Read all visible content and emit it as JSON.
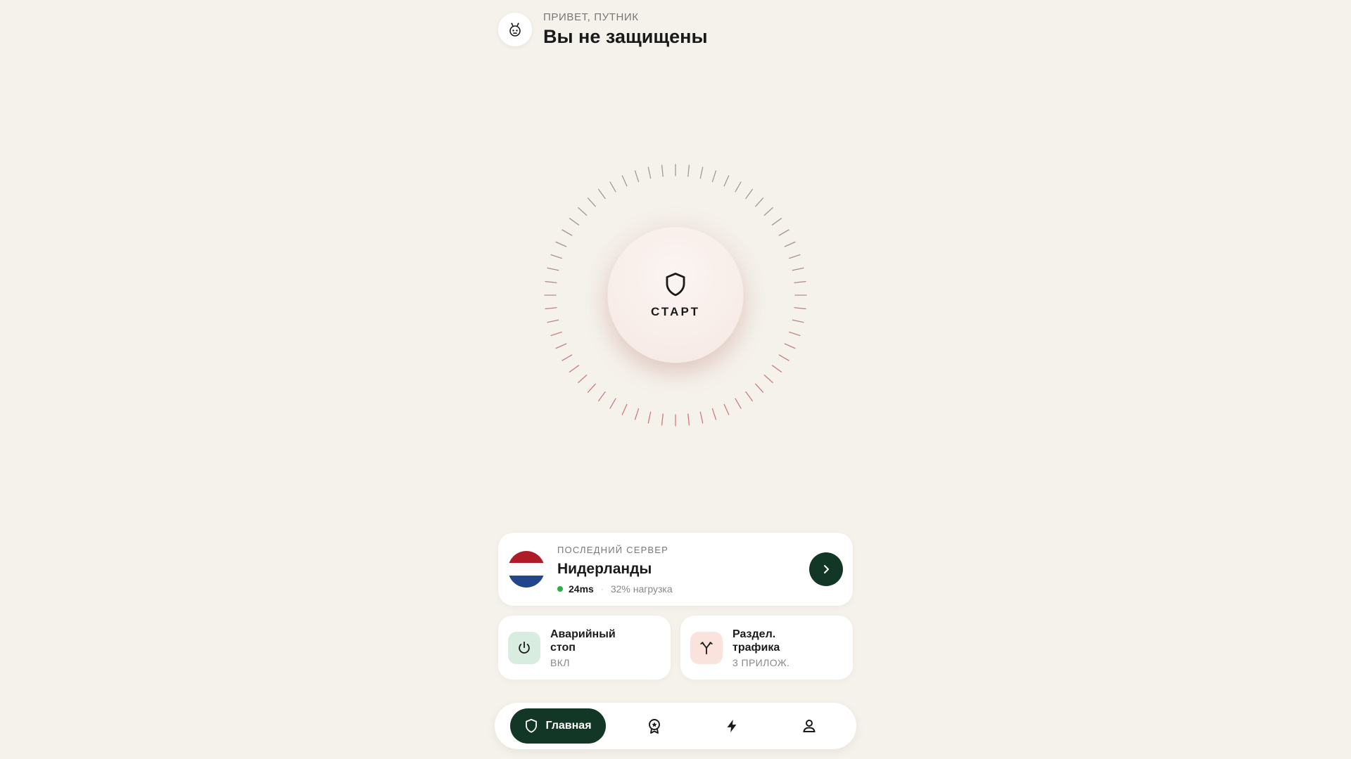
{
  "header": {
    "greeting": "ПРИВЕТ, ПУТНИК",
    "status_title": "Вы не защищены",
    "avatar_icon": "robot-icon"
  },
  "dial": {
    "button_label": "СТАРТ",
    "button_icon": "shield-icon",
    "tick_count": 60
  },
  "server": {
    "caption": "ПОСЛЕДНИЙ СЕРВЕР",
    "name": "Нидерланды",
    "ping": "24ms",
    "load": "32% нагрузка",
    "flag_colors": [
      "#ae1c28",
      "#ffffff",
      "#21468b"
    ],
    "status_color": "#27b24a",
    "action_icon": "chevron-right-icon"
  },
  "tiles": [
    {
      "title": "Аварийный стоп",
      "subtitle": "ВКЛ",
      "icon": "power-icon",
      "icon_bg": "#d9ece0"
    },
    {
      "title": "Раздел. трафика",
      "subtitle": "3 ПРИЛОЖ.",
      "icon": "split-icon",
      "icon_bg": "#fbe3dd"
    }
  ],
  "nav": {
    "home_label": "Главная",
    "items": [
      "shield-icon",
      "award-icon",
      "bolt-icon",
      "user-icon"
    ]
  },
  "colors": {
    "background": "#f5f1eb",
    "accent_dark": "#133726",
    "text": "#1a1a1a"
  }
}
